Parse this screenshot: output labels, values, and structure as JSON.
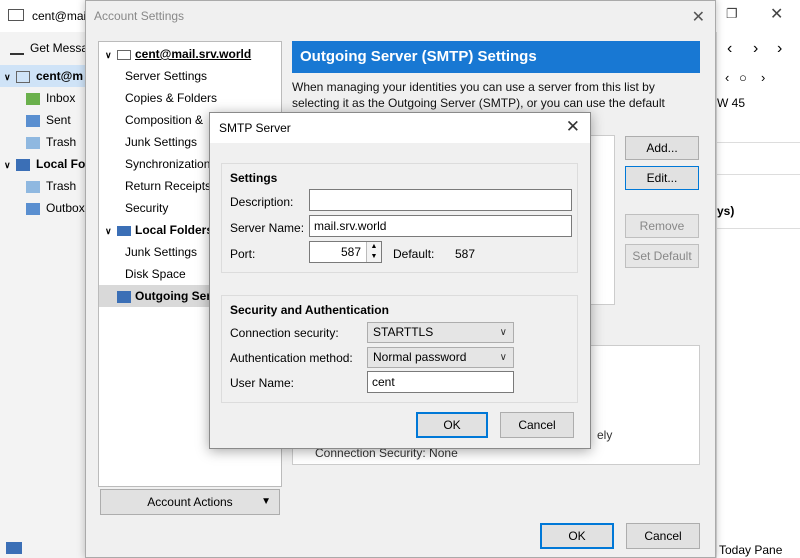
{
  "background": {
    "account_label": "cent@mai",
    "get_messages": "Get Messag",
    "folders": [
      {
        "label": "cent@m",
        "icon": "mail-account-icon"
      },
      {
        "label": "Inbox",
        "icon": "inbox-icon"
      },
      {
        "label": "Sent",
        "icon": "sent-icon"
      },
      {
        "label": "Trash",
        "icon": "trash-icon"
      },
      {
        "label": "Local Fol",
        "icon": "local-folder-icon"
      },
      {
        "label": "Trash",
        "icon": "trash-icon"
      },
      {
        "label": "Outbox",
        "icon": "outbox-icon"
      }
    ],
    "right_week": "W 45",
    "right_days": "ys)",
    "today_pane": "Today Pane"
  },
  "account_settings": {
    "title": "Account Settings",
    "tree": [
      {
        "label": "cent@mail.srv.world",
        "level": 0
      },
      {
        "label": "Server Settings",
        "level": 1
      },
      {
        "label": "Copies & Folders",
        "level": 1
      },
      {
        "label": "Composition &",
        "level": 1
      },
      {
        "label": "Junk Settings",
        "level": 1
      },
      {
        "label": "Synchronization",
        "level": 1
      },
      {
        "label": "Return Receipts",
        "level": 1
      },
      {
        "label": "Security",
        "level": 1
      },
      {
        "label": "Local Folders",
        "level": 0
      },
      {
        "label": "Junk Settings",
        "level": 1
      },
      {
        "label": "Disk Space",
        "level": 1
      },
      {
        "label": "Outgoing Ser",
        "level": 0
      }
    ],
    "account_actions": "Account Actions",
    "header": "Outgoing Server (SMTP) Settings",
    "description": "When managing your identities you can use a server from this list by selecting it as the Outgoing Server (SMTP), or you can use the default server",
    "buttons": {
      "add": "Add...",
      "edit": "Edit...",
      "remove": "Remove",
      "set_default": "Set Default",
      "ok": "OK",
      "cancel": "Cancel"
    },
    "peek_ely": "ely",
    "peek_connsec": "Connection Security: None"
  },
  "smtp_dialog": {
    "title": "SMTP Server",
    "settings_group": "Settings",
    "description_label": "Description:",
    "description_value": "",
    "server_name_label": "Server Name:",
    "server_name_value": "mail.srv.world",
    "port_label": "Port:",
    "port_value": "587",
    "default_label": "Default:",
    "default_value": "587",
    "security_group": "Security and Authentication",
    "connection_security_label": "Connection security:",
    "connection_security_value": "STARTTLS",
    "auth_method_label": "Authentication method:",
    "auth_method_value": "Normal password",
    "user_name_label": "User Name:",
    "user_name_value": "cent",
    "ok": "OK",
    "cancel": "Cancel"
  },
  "colors": {
    "header_blue": "#1878d3",
    "focus_blue": "#0078d7"
  }
}
